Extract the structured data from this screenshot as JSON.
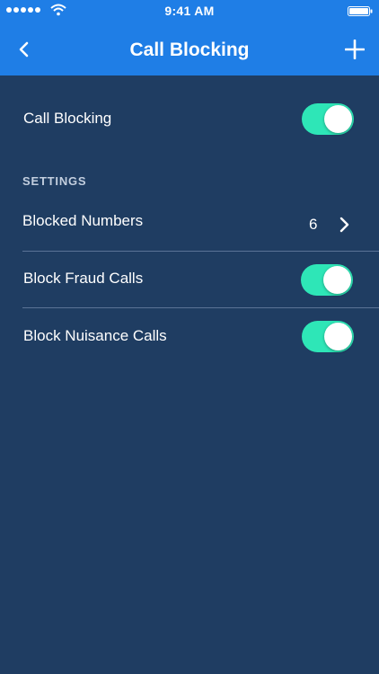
{
  "status_bar": {
    "time": "9:41 AM",
    "signal_icon": "signal-dots-icon",
    "wifi_icon": "wifi-icon",
    "battery_icon": "battery-icon"
  },
  "nav": {
    "title": "Call Blocking",
    "back_icon": "chevron-left-icon",
    "add_icon": "plus-icon"
  },
  "main_toggle": {
    "label": "Call Blocking",
    "on": true
  },
  "settings": {
    "header": "SETTINGS",
    "blocked_numbers": {
      "label": "Blocked Numbers",
      "count": "6"
    },
    "block_fraud": {
      "label": "Block Fraud Calls",
      "on": true
    },
    "block_nuisance": {
      "label": "Block Nuisance Calls",
      "on": true
    }
  },
  "colors": {
    "nav_background": "#1f7ee6",
    "page_background": "#1f3d62",
    "toggle_on": "#2ee6b7",
    "divider": "#5a7396"
  }
}
